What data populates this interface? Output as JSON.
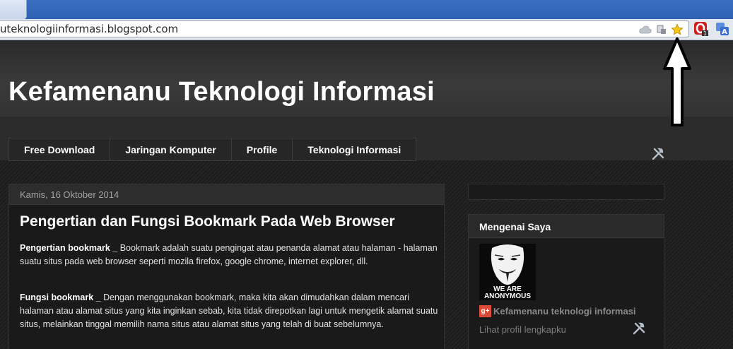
{
  "browser": {
    "url": "uteknologiinformasi.blogspot.com",
    "omnibox_icons": [
      "cloud-icon",
      "page-action-icon",
      "bookmark-star-icon"
    ],
    "extensions": [
      {
        "name": "opera-extension-icon",
        "badge": "1"
      },
      {
        "name": "translate-icon",
        "glyph": "A"
      }
    ]
  },
  "blog": {
    "title": "Kefamenanu Teknologi Informasi",
    "nav_tabs": [
      "Free Download",
      "Jaringan Komputer",
      "Profile",
      "Teknologi Informasi"
    ]
  },
  "post": {
    "date": "Kamis, 16 Oktober 2014",
    "title": "Pengertian dan Fungsi Bookmark Pada Web Browser",
    "p1_lead": "Pengertian bookmark _",
    "p1_text": "  Bookmark adalah suatu pengingat atau penanda alamat atau halaman - halaman  suatu situs pada web browser seperti mozila firefox, google chrome, internet explorer, dll.",
    "p2_lead": "Fungsi bookmark  _",
    "p2_text": "  Dengan menggunakan bookmark, maka kita akan dimudahkan dalam mencari halaman atau alamat situs yang kita inginkan sebab, kita tidak direpotkan lagi untuk mengetik alamat suatu situs, melainkan tinggal memilih nama situs atau alamat situs yang telah di buat  sebelumnya."
  },
  "sidebar": {
    "widget_title": "Mengenai Saya",
    "avatar_caption_1": "WE ARE",
    "avatar_caption_2": "ANONYMOUS",
    "gplus_label": "g+",
    "profile_name": "Kefamenanu teknologi informasi",
    "profile_link": "Lihat profil lengkapku"
  },
  "colors": {
    "accent_star": "#f5c518",
    "gplus": "#dd4b39",
    "tabstrip": "#2f62b3"
  }
}
